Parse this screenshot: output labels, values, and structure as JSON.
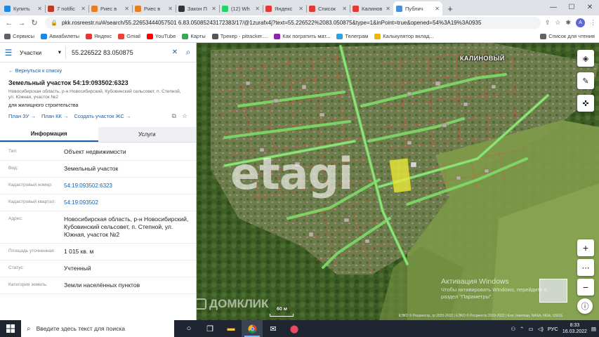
{
  "browser": {
    "tabs": [
      {
        "title": "Купить",
        "color": "#1e88e5",
        "active": false
      },
      {
        "title": "7 notific",
        "color": "#c0392b",
        "active": false
      },
      {
        "title": "Риес в",
        "color": "#e67e22",
        "active": false
      },
      {
        "title": "Риес в",
        "color": "#e67e22",
        "active": false
      },
      {
        "title": "Закон П",
        "color": "#333333",
        "active": false
      },
      {
        "title": "(12) Wh",
        "color": "#25d366",
        "active": false
      },
      {
        "title": "Яндекс",
        "color": "#e53935",
        "active": false
      },
      {
        "title": "Список",
        "color": "#e53935",
        "active": false
      },
      {
        "title": "Калинов",
        "color": "#e53935",
        "active": false
      },
      {
        "title": "Публич",
        "color": "#4a90d9",
        "active": true
      }
    ],
    "new_tab": "+",
    "url": "pkk.rosreestr.ru/#/search/55.22653444057501 6.83.05085243172383/17/@1zurafx4j?text=55.226522%2083.050875&type=1&inPoint=true&opened=54%3A19%3A0935",
    "avatar_letter": "A",
    "bookmarks": [
      {
        "label": "Сервисы",
        "color": "#5f6368"
      },
      {
        "label": "Авиабилеты",
        "color": "#1e88e5"
      },
      {
        "label": "Яндекс",
        "color": "#e53935"
      },
      {
        "label": "Gmail",
        "color": "#ea4335"
      },
      {
        "label": "YouTube",
        "color": "#ff0000"
      },
      {
        "label": "Карты",
        "color": "#34a853"
      },
      {
        "label": "Трекер - pitracker....",
        "color": "#555555"
      },
      {
        "label": "Как погратить мат...",
        "color": "#8e24aa"
      },
      {
        "label": "Телеграм",
        "color": "#2aa3df"
      },
      {
        "label": "Калькулятор вклад...",
        "color": "#f4b400"
      }
    ],
    "reading_list": "Список для чтения"
  },
  "panel": {
    "search_type": "Участки",
    "search_value": "55.226522 83.050875",
    "back_link": "← Вернуться к списку",
    "title": "Земельный участок 54:19:093502:6323",
    "address_short": "Новосибирская область, р-н Новосибирский, Кубовинский сельсовет, п. Степной, ул. Южная, участок №2",
    "usage": "для жилищного строительства",
    "actions": [
      "План ЗУ →",
      "План КК →",
      "Создать участок ЖС →"
    ],
    "tabs": [
      "Информация",
      "Услуги"
    ],
    "properties": [
      {
        "label": "Тип:",
        "value": "Объект недвижимости",
        "link": false
      },
      {
        "label": "Вид:",
        "value": "Земельный участок",
        "link": false
      },
      {
        "label": "Кадастровый номер:",
        "value": "54:19:093502:6323",
        "link": true
      },
      {
        "label": "Кадастровый квартал:",
        "value": "54:19:093502",
        "link": true
      },
      {
        "label": "Адрес:",
        "value": "Новосибирская область, р-н Новосибирский, Кубовинский сельсовет, п. Степной, ул. Южная, участок №2",
        "link": false
      },
      {
        "label": "Площадь уточненная:",
        "value": "1 015 кв. м",
        "link": false
      },
      {
        "label": "Статус:",
        "value": "Учтенный",
        "link": false
      },
      {
        "label": "Категория земель:",
        "value": "Земли населённых пунктов",
        "link": false
      }
    ]
  },
  "map": {
    "locality_label": "КАЛИНОВЫЙ",
    "watermark": "etagi",
    "scale_label": "60 м",
    "attribution": "ЕЭКО © Росреестр, гр 2020-2022 | ЕЭКО © Росреестр 2019-2022 | Esri, Intermap, NASA, NGA, USGS",
    "activation_title": "Активация Windows",
    "activation_sub1": "Чтобы активировать Windows, перейдите в",
    "activation_sub2": "раздел \"Параметры\".",
    "domclick": "ДОМКЛИК"
  },
  "taskbar": {
    "search_placeholder": "Введите здесь текст для поиска",
    "language": "РУС",
    "time": "8:33",
    "date": "16.03.2022"
  }
}
